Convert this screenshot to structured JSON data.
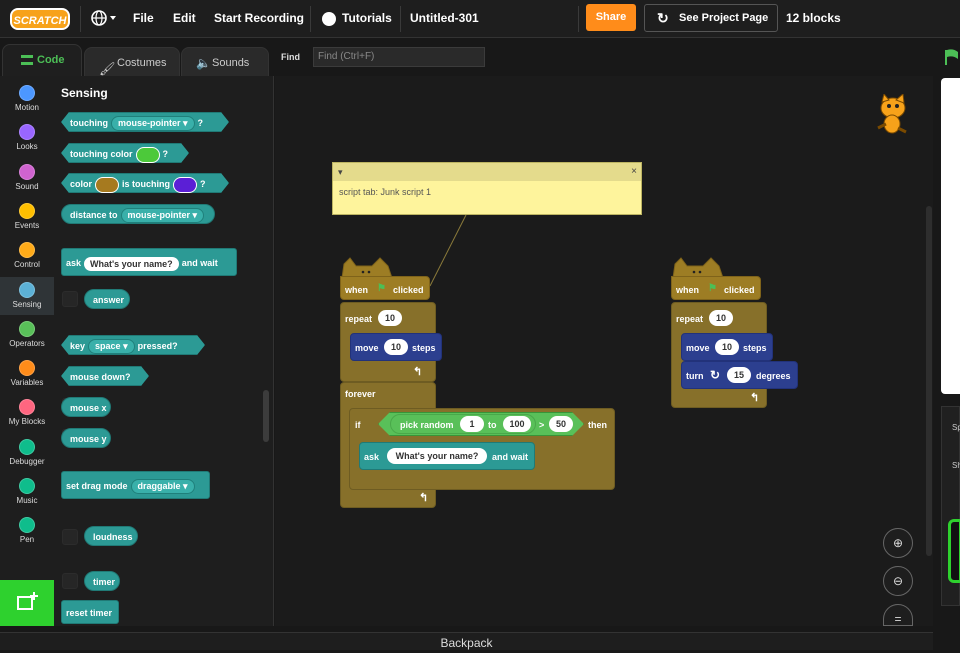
{
  "menubar": {
    "logo": "SCRATCH",
    "file": "File",
    "edit": "Edit",
    "record": "Start Recording",
    "tutorials": "Tutorials",
    "project_title": "Untitled-301",
    "share": "Share",
    "see_page": "See Project Page",
    "block_count": "12 blocks"
  },
  "tabs": {
    "code": "Code",
    "costumes": "Costumes",
    "sounds": "Sounds"
  },
  "find": {
    "label": "Find",
    "placeholder": "Find (Ctrl+F)"
  },
  "categories": [
    {
      "label": "Motion",
      "color": "#4c97ff"
    },
    {
      "label": "Looks",
      "color": "#9966ff"
    },
    {
      "label": "Sound",
      "color": "#cf63cf"
    },
    {
      "label": "Events",
      "color": "#ffbf00"
    },
    {
      "label": "Control",
      "color": "#ffab19"
    },
    {
      "label": "Sensing",
      "color": "#5cb1d6"
    },
    {
      "label": "Operators",
      "color": "#59c059"
    },
    {
      "label": "Variables",
      "color": "#ff8c1a"
    },
    {
      "label": "My Blocks",
      "color": "#ff6680"
    },
    {
      "label": "Debugger",
      "color": "#0fbd8c"
    },
    {
      "label": "Music",
      "color": "#0fbd8c"
    },
    {
      "label": "Pen",
      "color": "#0fbd8c"
    }
  ],
  "palette": {
    "title": "Sensing",
    "touching": "touching",
    "touching_dd": "mouse-pointer",
    "q": "?",
    "touching_color": "touching color",
    "color": "color",
    "is_touching": "is touching",
    "distance_to": "distance to",
    "distance_dd": "mouse-pointer",
    "ask": "ask",
    "ask_value": "What's your name?",
    "and_wait": "and wait",
    "answer": "answer",
    "key": "key",
    "key_dd": "space",
    "pressed": "pressed?",
    "mouse_down": "mouse down?",
    "mouse_x": "mouse x",
    "mouse_y": "mouse y",
    "set_drag": "set drag mode",
    "drag_dd": "draggable",
    "loudness": "loudness",
    "timer": "timer",
    "reset_timer": "reset timer"
  },
  "comment": {
    "text": "script tab: Junk script 1",
    "close": "×"
  },
  "script1": {
    "when": "when",
    "clicked": "clicked",
    "repeat": "repeat",
    "repeat_n": "10",
    "move": "move",
    "move_n": "10",
    "steps": "steps",
    "forever": "forever",
    "if": "if",
    "pick_random": "pick random",
    "from": "1",
    "to": "to",
    "to_val": "100",
    "gt": ">",
    "cmp": "50",
    "then": "then",
    "ask": "ask",
    "ask_val": "What's your name?",
    "and_wait": "and wait"
  },
  "script2": {
    "when": "when",
    "clicked": "clicked",
    "repeat": "repeat",
    "repeat_n": "10",
    "move": "move",
    "move_n": "10",
    "steps": "steps",
    "turn": "turn",
    "turn_n": "15",
    "degrees": "degrees"
  },
  "backpack": "Backpack",
  "colors": {
    "events": "#9d7d24",
    "control": "#87702a",
    "motion": "#2c3f8f",
    "sensing": "#2c9a95",
    "operators": "#59c059",
    "accent": "#ff8c1a"
  }
}
